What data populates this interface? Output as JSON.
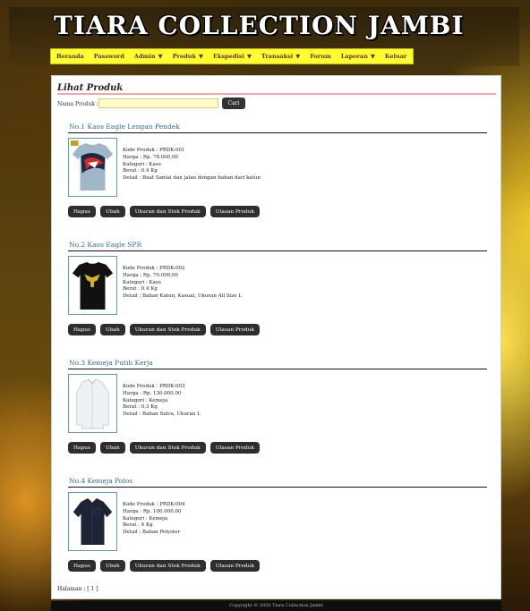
{
  "site": {
    "title": "TIARA COLLECTION JAMBI"
  },
  "nav": [
    {
      "label": "Beranda",
      "caret": ""
    },
    {
      "label": "Password",
      "caret": ""
    },
    {
      "label": "Admin",
      "caret": "▼"
    },
    {
      "label": "Produk",
      "caret": "▼"
    },
    {
      "label": "Ekspedisi",
      "caret": "▼"
    },
    {
      "label": "Transaksi",
      "caret": "▼"
    },
    {
      "label": "Forum",
      "caret": ""
    },
    {
      "label": "Laporan",
      "caret": "▼"
    },
    {
      "label": "Keluar",
      "caret": ""
    }
  ],
  "page": {
    "title": "Lihat Produk",
    "search_label": "Nama Produk :",
    "search_value": "",
    "search_button": "Cari"
  },
  "products": [
    {
      "title": "No.1 Kaos Eagle Lengan Pendek",
      "kode": "Kode Produk : PRDK-001",
      "harga": "Harga : Rp. 78.000,00",
      "kategori": "Kategori : Kaos",
      "berat": "Berat : 0.4 Kg",
      "detail": "Detail : Buat Santai dan jalan dengan bahan dari katun",
      "image": "tshirt-eagle-print"
    },
    {
      "title": "No.2 Kaos Eagle SPR",
      "kode": "Kode Produk : PRDK-002",
      "harga": "Harga : Rp. 70.000,00",
      "kategori": "Kategori : Kaos",
      "berat": "Berat : 0.4 Kg",
      "detail": "Detail : Bahan Katun, Kasual, Ukuran All Size L",
      "image": "tshirt-black-eagle"
    },
    {
      "title": "No.3 Kemeja Putih Kerja",
      "kode": "Kode Produk : PRDK-003",
      "harga": "Harga : Rp. 130.000,00",
      "kategori": "Kategori : Kemeja",
      "berat": "Berat : 0.3 Kg",
      "detail": "Detail : Bahan Sutra, Ukuran L",
      "image": "shirt-white"
    },
    {
      "title": "No.4 Kemeja Polos",
      "kode": "Kode Produk : PRDK-004",
      "harga": "Harga : Rp. 100.000,00",
      "kategori": "Kategori : Kemeja",
      "berat": "Berat : 6 Kg",
      "detail": "Detail : Bahan Polyster",
      "image": "shirt-navy"
    }
  ],
  "actions": {
    "hapus": "Hapus",
    "ubah": "Ubah",
    "stok": "Ukuran dan Stok Produk",
    "ulasan": "Ulasan Produk"
  },
  "pagination": "Halaman : [ 1 ]",
  "footer": "Copyright © 2020 Tiara Collection Jambi",
  "colors": {
    "nav_bg": "#ffff33",
    "title_accent": "#2d6e8a",
    "button_bg": "#2e2e2e"
  }
}
